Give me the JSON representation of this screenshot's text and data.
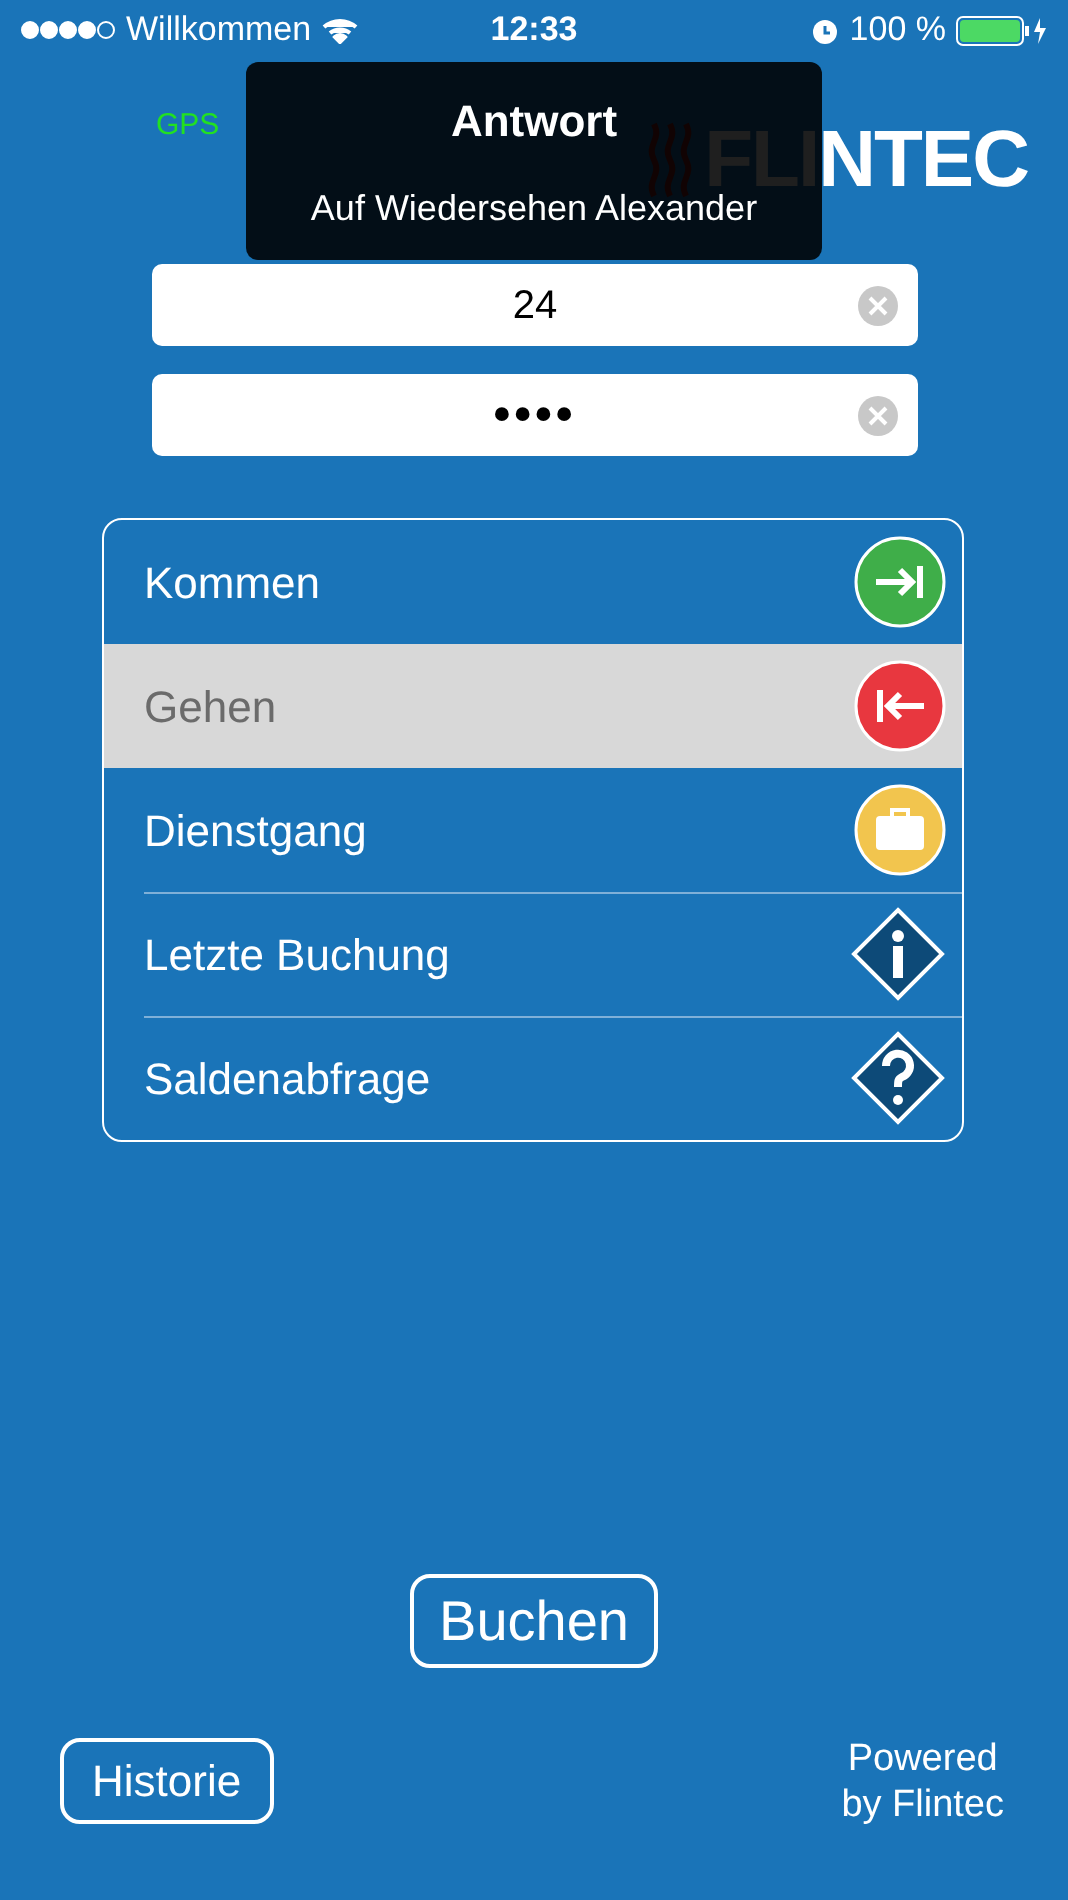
{
  "status_bar": {
    "carrier": "Willkommen",
    "time": "12:33",
    "battery": "100 %"
  },
  "gps": "GPS",
  "logo": "FLINTEC",
  "fields": [
    {
      "value": "24",
      "kind": "text"
    },
    {
      "value": "••••",
      "kind": "password"
    }
  ],
  "menu": [
    {
      "label": "Kommen",
      "kind": "in",
      "selected": false
    },
    {
      "label": "Gehen",
      "kind": "out",
      "selected": true
    },
    {
      "label": "Dienstgang",
      "kind": "case",
      "selected": false
    },
    {
      "label": "Letzte Buchung",
      "kind": "info",
      "selected": false
    },
    {
      "label": "Saldenabfrage",
      "kind": "help",
      "selected": false
    }
  ],
  "book_button": "Buchen",
  "history_button": "Historie",
  "powered": "Powered\nby Flintec",
  "toast": {
    "title": "Antwort",
    "message": "Auf Wiedersehen Alexander"
  }
}
